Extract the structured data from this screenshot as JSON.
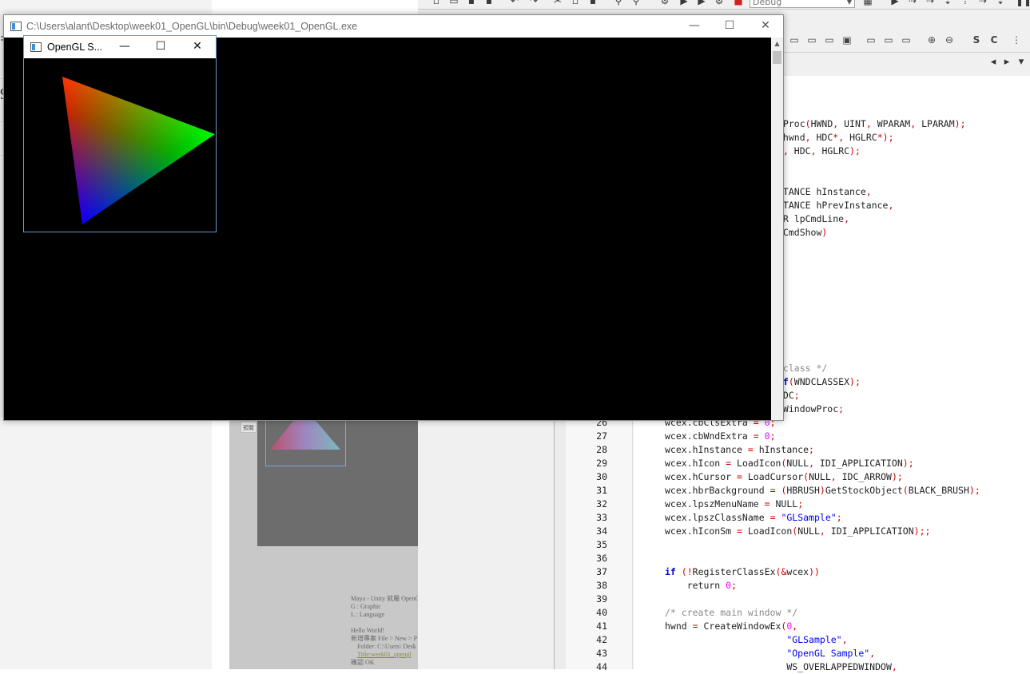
{
  "console_window": {
    "title": "C:\\Users\\alant\\Desktop\\week01_OpenGL\\bin\\Debug\\week01_OpenGL.exe",
    "minimize": "—",
    "maximize": "☐",
    "close": "✕"
  },
  "opengl_window": {
    "title": "OpenGL S...",
    "minimize": "—",
    "maximize": "☐",
    "close": "✕",
    "triangle_colors": [
      "#ff0000",
      "#00ff00",
      "#0000ff"
    ]
  },
  "ide": {
    "config_value": "Debug",
    "line_numbers": [
      "26",
      "27",
      "28",
      "29",
      "30",
      "31",
      "32",
      "33",
      "34",
      "35",
      "36",
      "37",
      "38",
      "39",
      "40",
      "41",
      "42",
      "43",
      "44"
    ]
  },
  "code_partial": [
    "wProc(HWND, UINT, WPARAM, LPARAM);",
    " hwnd, HDC*, HGLRC*);",
    "), HDC, HGLRC);",
    "STANCE hInstance,",
    "STANCE hPrevInstance,",
    "TR lpCmdLine,",
    "nCmdShow)",
    " class */",
    "of(WNDCLASSEX);",
    "HDC;",
    " WindowProc;"
  ],
  "code_lines": [
    "wcex.cbClsExtra = 0;",
    "wcex.cbWndExtra = 0;",
    "wcex.hInstance = hInstance;",
    "wcex.hIcon = LoadIcon(NULL, IDI_APPLICATION);",
    "wcex.hCursor = LoadCursor(NULL, IDC_ARROW);",
    "wcex.hbrBackground = (HBRUSH)GetStockObject(BLACK_BRUSH);",
    "wcex.lpszMenuName = NULL;",
    "wcex.lpszClassName = \"GLSample\";",
    "wcex.hIconSm = LoadIcon(NULL, IDI_APPLICATION);;",
    "",
    "",
    "if (!RegisterClassEx(&wcex))",
    "    return 0;",
    "",
    "/* create main window */",
    "hwnd = CreateWindowEx(0,",
    "                      \"GLSample\",",
    "                      \"OpenGL Sample\",",
    "                      WS_OVERLAPPEDWINDOW,"
  ],
  "doc_snippet": {
    "button": "預覽",
    "lines": [
      "Maya - Unity 就屬 OpenGL",
      "G : Graphic",
      "L : Language",
      "",
      "Hello World!",
      "新增專案 File > New > P",
      "Folder: C:\\Users\\ Desk",
      "Title:week01_opengl",
      "確認 OK"
    ]
  },
  "left_panel_fragments": [
    "=",
    "9"
  ]
}
